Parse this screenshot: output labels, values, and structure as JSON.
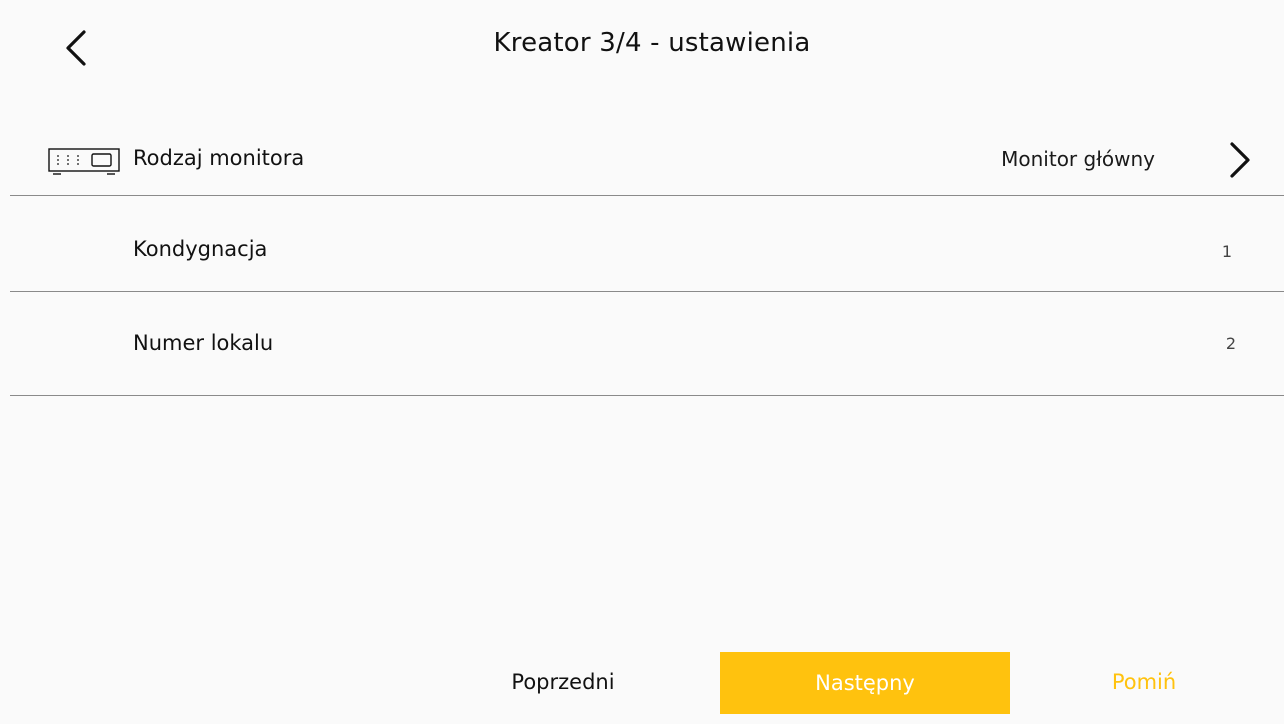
{
  "header": {
    "title": "Kreator 3/4 - ustawienia",
    "back_icon": "chevron-left-icon"
  },
  "settings": {
    "monitor_type": {
      "label": "Rodzaj monitora",
      "value": "Monitor główny",
      "icon": "monitor-device-icon",
      "chevron_icon": "chevron-right-icon"
    },
    "floor": {
      "label": "Kondygnacja",
      "value": "1"
    },
    "unit_number": {
      "label": "Numer lokalu",
      "value": "2"
    }
  },
  "footer": {
    "prev_label": "Poprzedni",
    "next_label": "Następny",
    "skip_label": "Pomiń"
  },
  "colors": {
    "accent": "#ffc20e",
    "background": "#fafafa",
    "divider": "#8a8a8a"
  }
}
